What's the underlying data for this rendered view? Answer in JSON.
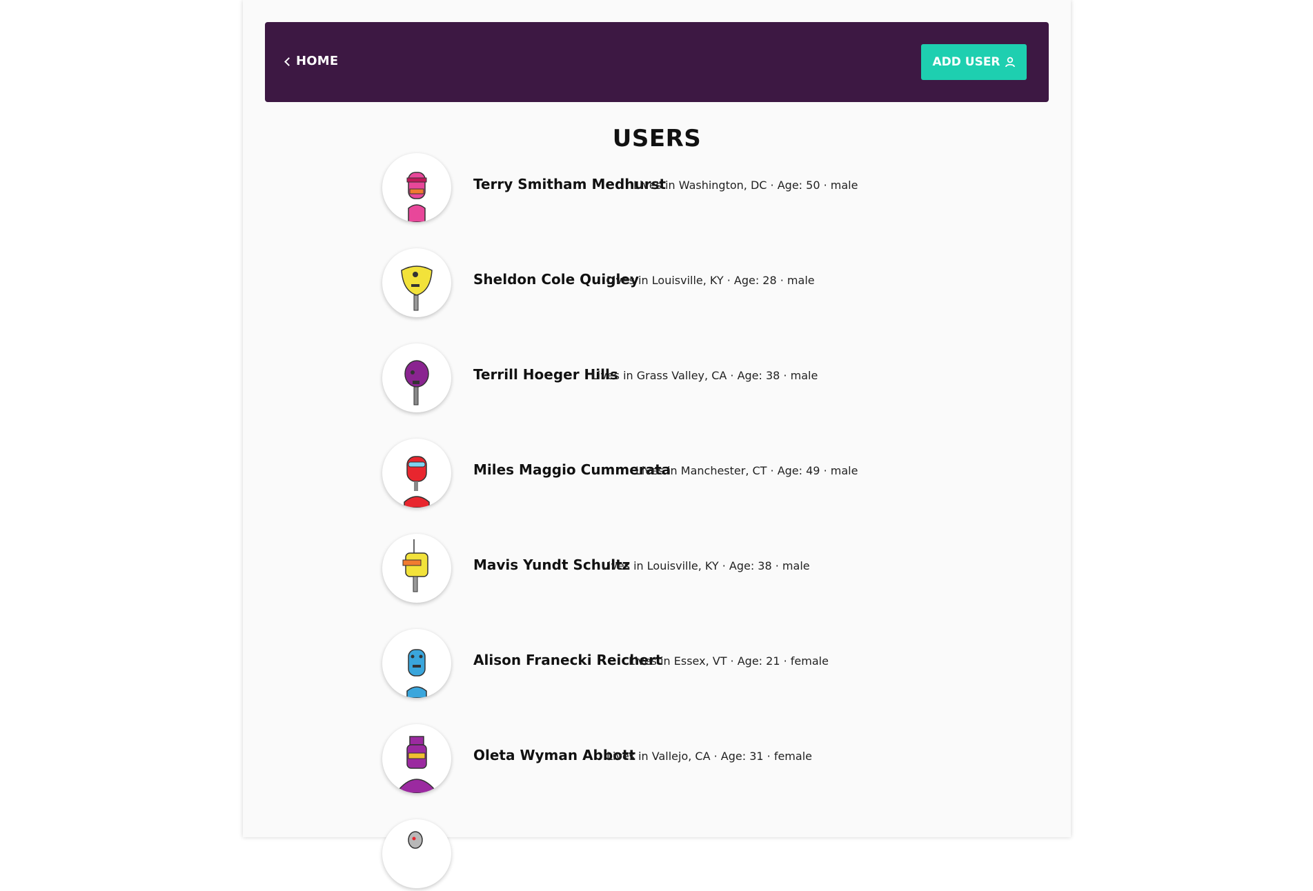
{
  "navbar": {
    "home_label": "HOME",
    "add_user_label": "ADD USER",
    "background": "#3d1843",
    "button_color": "#1ecfb0"
  },
  "page": {
    "title": "USERS"
  },
  "users": [
    {
      "name": "Terry Smitham Medhurst",
      "info": "Lives in Washington, DC · Age: 50 · male",
      "avatar": "pink-robot-icon",
      "color": "#e8479a"
    },
    {
      "name": "Sheldon Cole Quigley",
      "info": "Lives in Louisville, KY · Age: 28 · male",
      "avatar": "yellow-robot-icon",
      "color": "#f2e23a"
    },
    {
      "name": "Terrill Hoeger Hills",
      "info": "Lives in Grass Valley, CA · Age: 38 · male",
      "avatar": "purple-robot-icon",
      "color": "#8a2490"
    },
    {
      "name": "Miles Maggio Cummerata",
      "info": "Lives in Manchester, CT · Age: 49 · male",
      "avatar": "red-robot-icon",
      "color": "#e8262e"
    },
    {
      "name": "Mavis Yundt Schultz",
      "info": "Lives in Louisville, KY · Age: 38 · male",
      "avatar": "yellow-robot-icon",
      "color": "#f2e23a"
    },
    {
      "name": "Alison Franecki Reichert",
      "info": "Lives in Essex, VT · Age: 21 · female",
      "avatar": "blue-robot-icon",
      "color": "#3aa6dc"
    },
    {
      "name": "Oleta Wyman Abbott",
      "info": "Lives in Vallejo, CA · Age: 31 · female",
      "avatar": "purple-robot-icon",
      "color": "#9b2aa0"
    },
    {
      "name": "",
      "info": "",
      "avatar": "grey-robot-icon",
      "color": "#b8b8b8"
    }
  ]
}
